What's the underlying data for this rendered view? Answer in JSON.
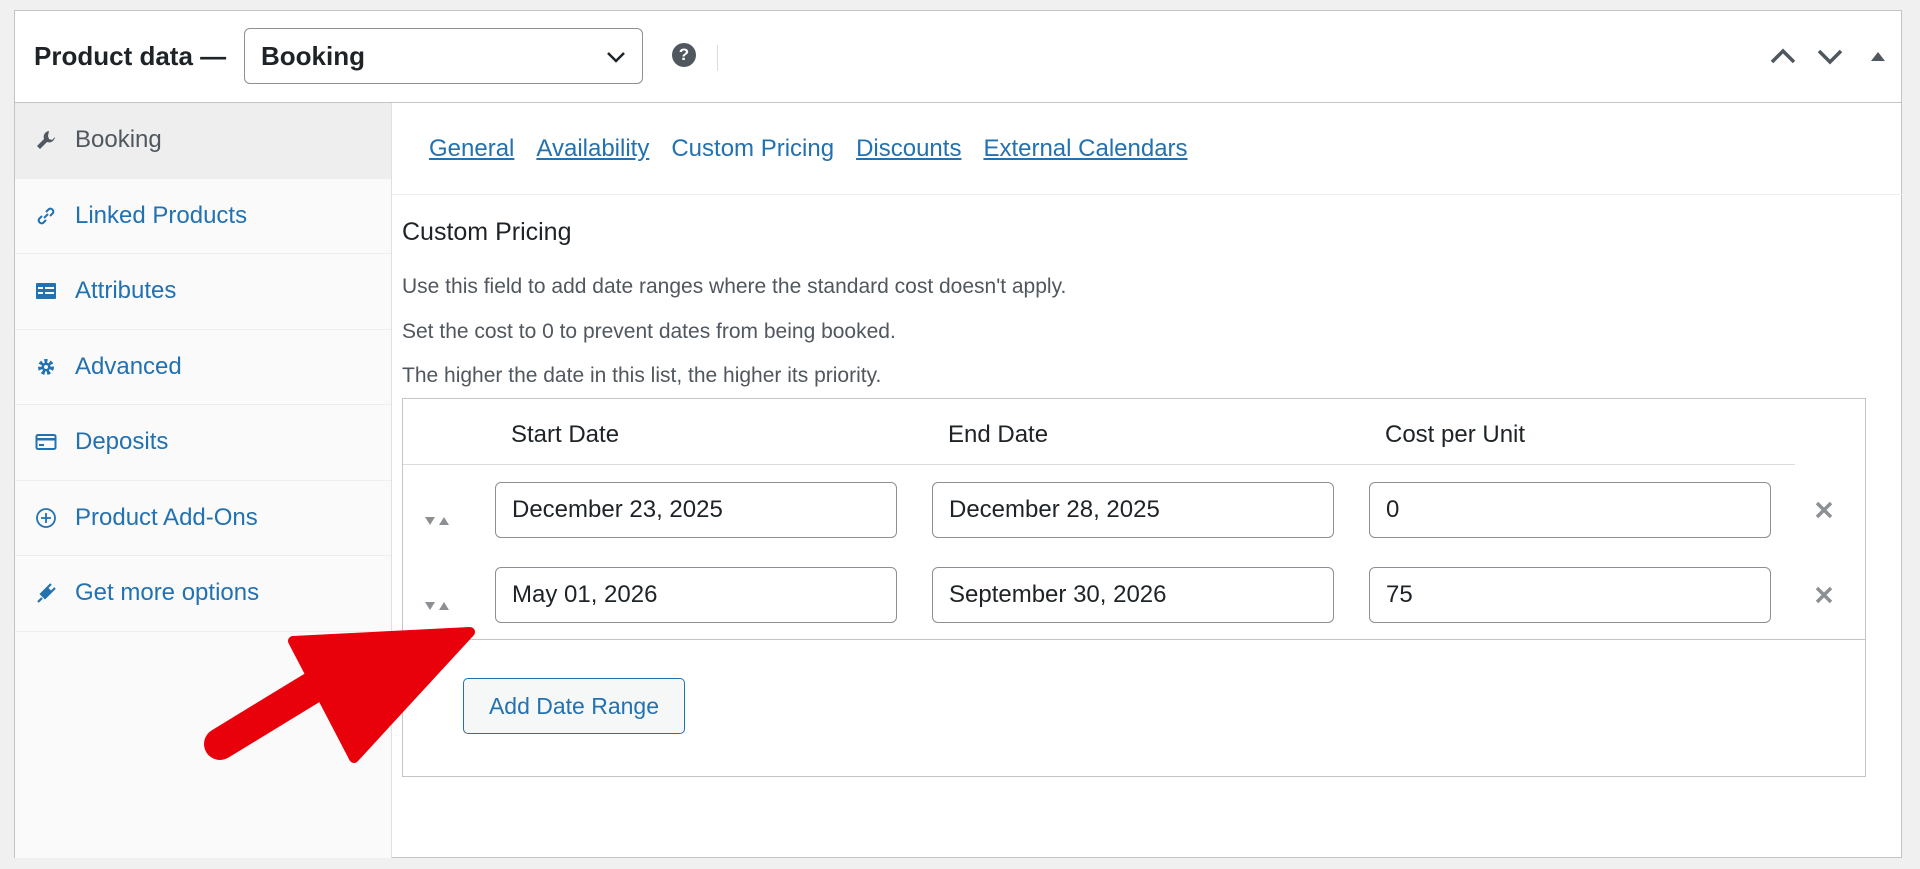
{
  "header": {
    "title": "Product data —",
    "product_type": "Booking",
    "help_icon": "?"
  },
  "sidebar": {
    "items": [
      {
        "label": "Booking",
        "icon": "wrench-icon",
        "active": true
      },
      {
        "label": "Linked Products",
        "icon": "link-icon"
      },
      {
        "label": "Attributes",
        "icon": "list-card-icon"
      },
      {
        "label": "Advanced",
        "icon": "gear-icon"
      },
      {
        "label": "Deposits",
        "icon": "credit-card-icon"
      },
      {
        "label": "Product Add-Ons",
        "icon": "plus-circle-icon"
      },
      {
        "label": "Get more options",
        "icon": "plugin-icon"
      }
    ]
  },
  "tabs": [
    {
      "label": "General"
    },
    {
      "label": "Availability"
    },
    {
      "label": "Custom Pricing",
      "current": true
    },
    {
      "label": "Discounts"
    },
    {
      "label": "External Calendars"
    }
  ],
  "section": {
    "title": "Custom Pricing",
    "descriptions": [
      "Use this field to add date ranges where the standard cost doesn't apply.",
      "Set the cost to 0 to prevent dates from being booked.",
      "The higher the date in this list, the higher its priority."
    ]
  },
  "table": {
    "headers": [
      "Start Date",
      "End Date",
      "Cost per Unit"
    ],
    "rows": [
      {
        "start": "December 23, 2025",
        "end": "December 28, 2025",
        "cost": "0"
      },
      {
        "start": "May 01, 2026",
        "end": "September 30, 2026",
        "cost": "75"
      }
    ],
    "add_button": "Add Date Range"
  },
  "colors": {
    "link": "#2271b1",
    "annotation_arrow": "#e8000b"
  }
}
